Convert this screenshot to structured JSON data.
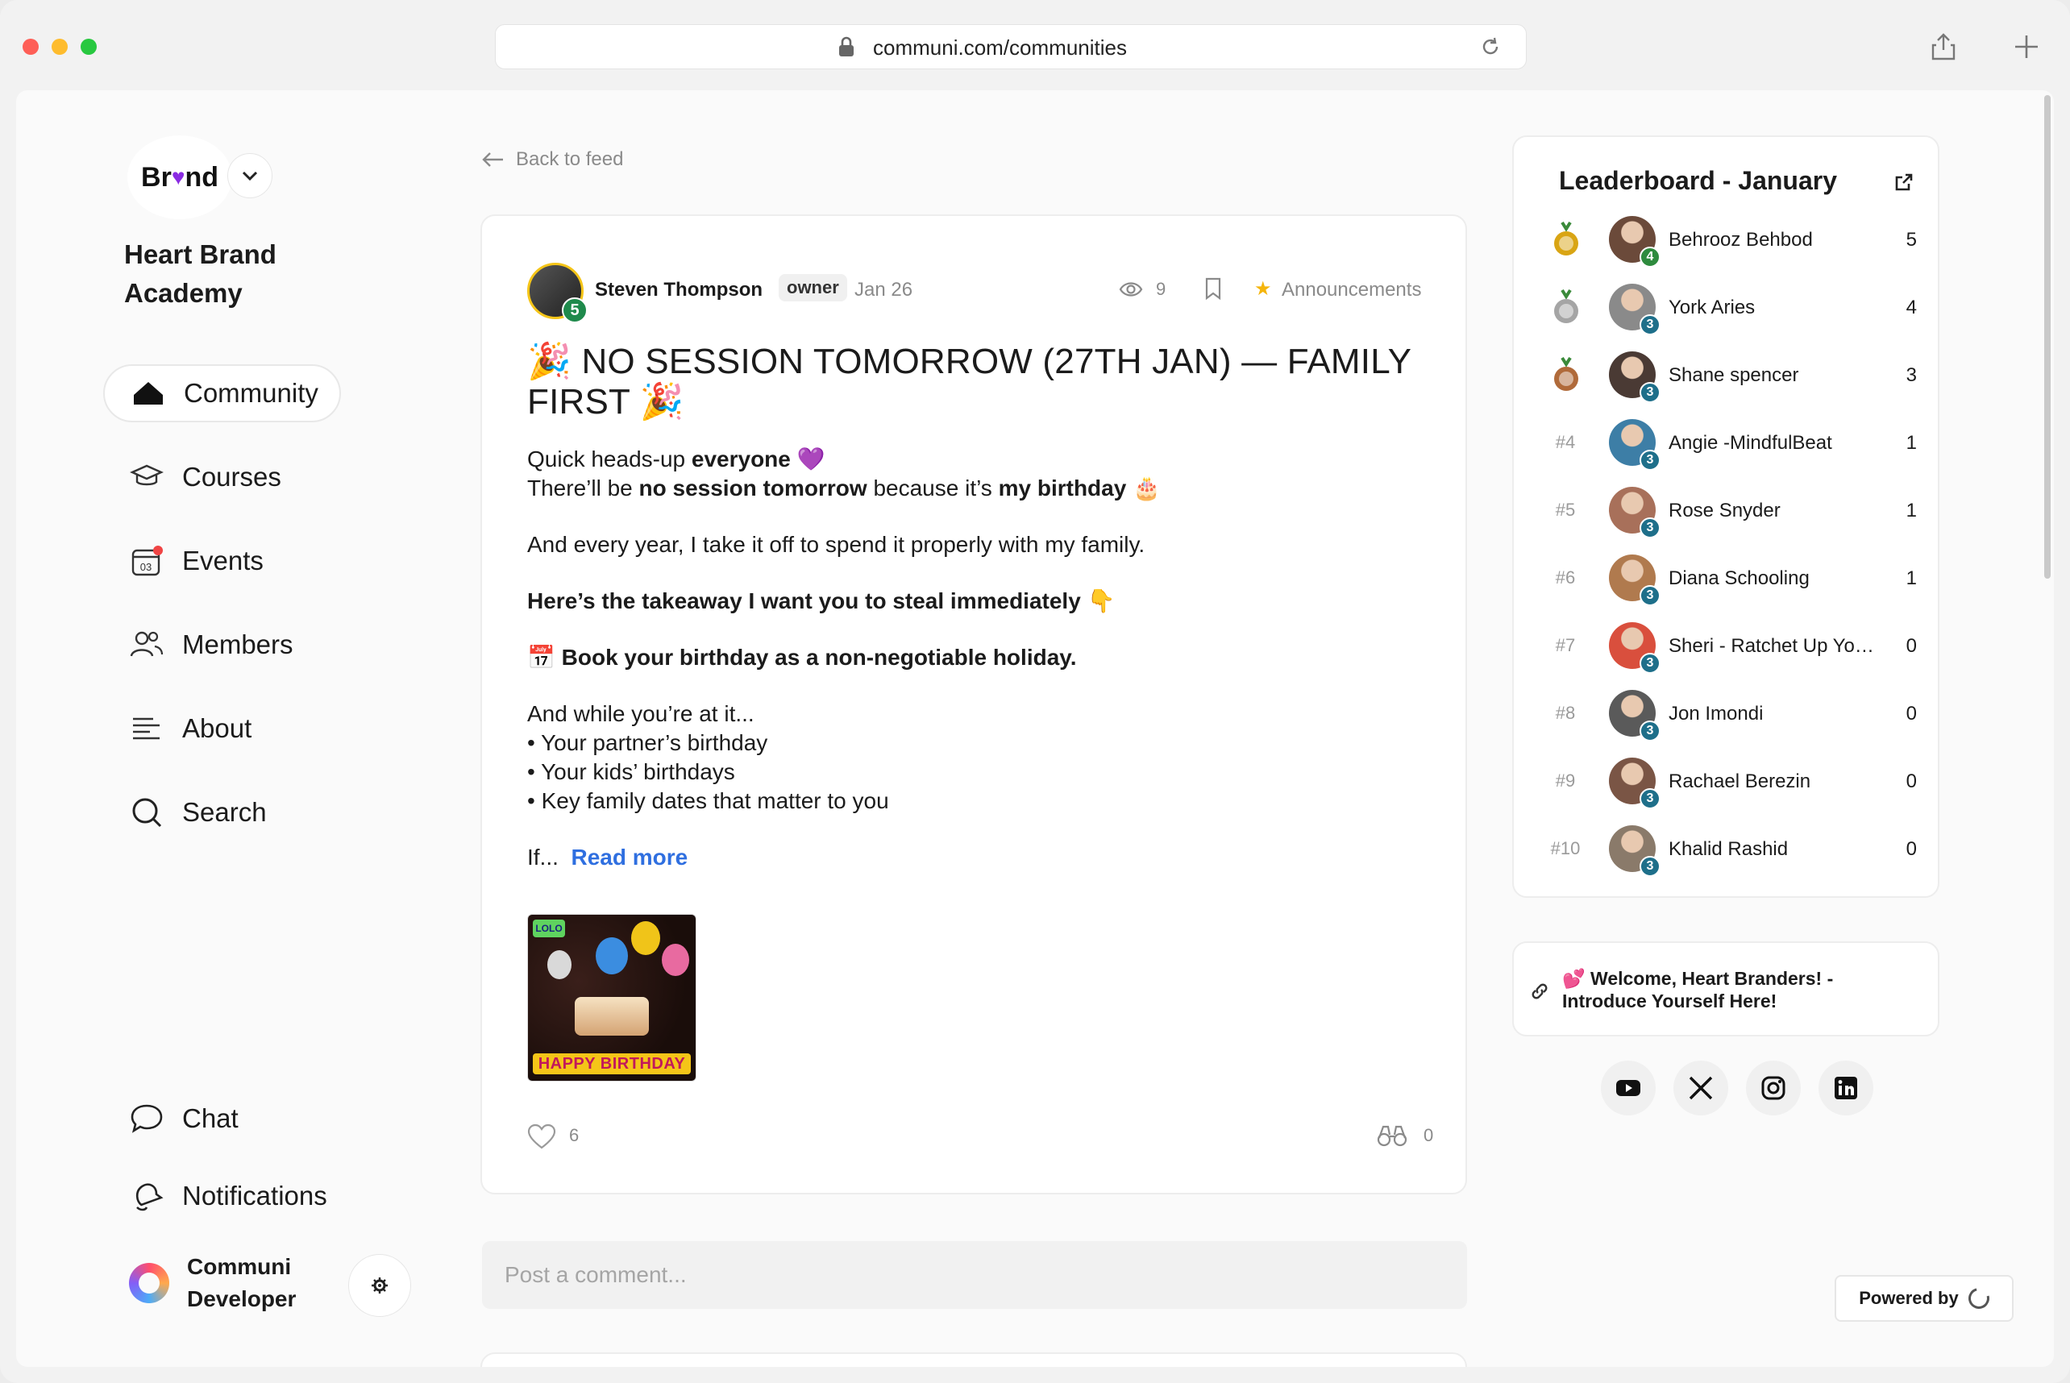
{
  "browser": {
    "url": "communi.com/communities"
  },
  "sidebar": {
    "brand_logo_text_pre": "Br",
    "brand_logo_heart": "♥",
    "brand_logo_text_post": "nd",
    "community_name": "Heart Brand Academy",
    "nav": [
      {
        "label": "Community",
        "icon": "home-icon",
        "active": true
      },
      {
        "label": "Courses",
        "icon": "graduation-cap-icon"
      },
      {
        "label": "Events",
        "icon": "calendar-icon"
      },
      {
        "label": "Members",
        "icon": "members-icon"
      },
      {
        "label": "About",
        "icon": "align-left-icon"
      },
      {
        "label": "Search",
        "icon": "search-icon"
      }
    ],
    "bottom_nav": [
      {
        "label": "Chat",
        "icon": "chat-bubble-icon"
      },
      {
        "label": "Notifications",
        "icon": "bell-icon"
      }
    ],
    "user": {
      "name": "Communi Developer"
    }
  },
  "feed": {
    "back_label": "Back to feed",
    "post": {
      "author": "Steven Thompson",
      "author_level": "5",
      "role": "owner",
      "date": "Jan 26",
      "views": "9",
      "category": "Announcements",
      "title_emoji": "🎉",
      "title": "NO SESSION TOMORROW (27TH JAN) — FAMILY FIRST",
      "body": {
        "line1_pre": "Quick heads-up ",
        "line1_bold": "everyone",
        "line1_emoji": "💜",
        "line2_pre": "There’ll be ",
        "line2_bold1": "no session tomorrow",
        "line2_mid": " because it’s ",
        "line2_bold2": "my birthday",
        "line2_emoji": "🎂",
        "line3": "And every year, I take it off to spend it properly with my family.",
        "line4": "Here’s the takeaway I want you to steal immediately",
        "line4_emoji": "👇",
        "line5_emoji": "📅",
        "line5": "Book your birthday as a non-negotiable holiday.",
        "line6": "And while you’re at it...",
        "bullets": [
          "• Your partner’s birthday",
          "• Your kids’ birthdays",
          "• Key family dates that matter to you"
        ],
        "truncated": "If...",
        "read_more": "Read more"
      },
      "image_caption": "HAPPY BIRTHDAY",
      "image_logo": "LOLO",
      "likes": "6",
      "watchers": "0"
    },
    "comment_placeholder": "Post a comment..."
  },
  "leaderboard": {
    "title": "Leaderboard - January",
    "rows": [
      {
        "rank": "",
        "medal": "gold",
        "name": "Behrooz Behbod",
        "level": "4",
        "points": "5",
        "avatar_color": "#6b4a3a"
      },
      {
        "rank": "",
        "medal": "silver",
        "name": "York Aries",
        "level": "3",
        "points": "4",
        "avatar_color": "#8a8a8a"
      },
      {
        "rank": "",
        "medal": "bronze",
        "name": "Shane spencer",
        "level": "3",
        "points": "3",
        "avatar_color": "#4a3a34"
      },
      {
        "rank": "#4",
        "name": "Angie -MindfulBeat",
        "level": "3",
        "points": "1",
        "avatar_color": "#3d7ea6"
      },
      {
        "rank": "#5",
        "name": "Rose Snyder",
        "level": "3",
        "points": "1",
        "avatar_color": "#a8705a"
      },
      {
        "rank": "#6",
        "name": "Diana Schooling",
        "level": "3",
        "points": "1",
        "avatar_color": "#b07a4e"
      },
      {
        "rank": "#7",
        "name": "Sheri - Ratchet Up You...",
        "level": "3",
        "points": "0",
        "avatar_color": "#d94f3d"
      },
      {
        "rank": "#8",
        "name": "Jon Imondi",
        "level": "3",
        "points": "0",
        "avatar_color": "#5a5a5a"
      },
      {
        "rank": "#9",
        "name": "Rachael Berezin",
        "level": "3",
        "points": "0",
        "avatar_color": "#7a5545"
      },
      {
        "rank": "#10",
        "name": "Khalid Rashid",
        "level": "3",
        "points": "0",
        "avatar_color": "#8a7a6a"
      }
    ]
  },
  "pinned_link": {
    "emoji": "💕",
    "text": "Welcome, Heart Branders! - Introduce Yourself Here!"
  },
  "social": [
    "youtube-icon",
    "x-icon",
    "instagram-icon",
    "linkedin-icon"
  ],
  "powered_by": "Powered by"
}
